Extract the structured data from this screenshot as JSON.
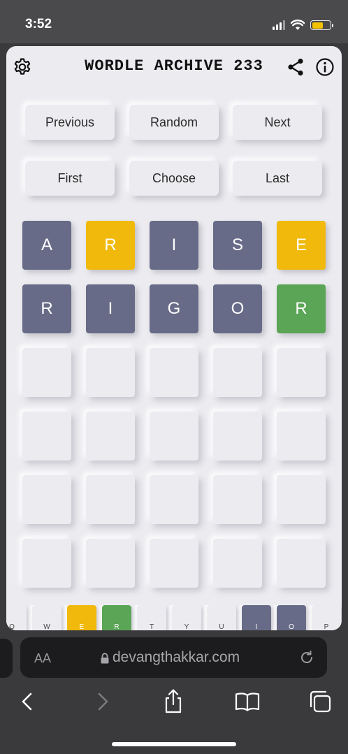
{
  "status": {
    "time": "3:52"
  },
  "header": {
    "title": "WORDLE ARCHIVE 233",
    "settings_icon": "gear-icon",
    "share_icon": "share-icon",
    "info_icon": "info-icon"
  },
  "nav": {
    "previous": "Previous",
    "random": "Random",
    "next": "Next",
    "first": "First",
    "choose": "Choose",
    "last": "Last"
  },
  "board": {
    "rows": [
      [
        {
          "letter": "A",
          "state": "absent"
        },
        {
          "letter": "R",
          "state": "present"
        },
        {
          "letter": "I",
          "state": "absent"
        },
        {
          "letter": "S",
          "state": "absent"
        },
        {
          "letter": "E",
          "state": "present"
        }
      ],
      [
        {
          "letter": "R",
          "state": "absent"
        },
        {
          "letter": "I",
          "state": "absent"
        },
        {
          "letter": "G",
          "state": "absent"
        },
        {
          "letter": "O",
          "state": "absent"
        },
        {
          "letter": "R",
          "state": "correct"
        }
      ],
      [
        {
          "letter": "",
          "state": "empty"
        },
        {
          "letter": "",
          "state": "empty"
        },
        {
          "letter": "",
          "state": "empty"
        },
        {
          "letter": "",
          "state": "empty"
        },
        {
          "letter": "",
          "state": "empty"
        }
      ],
      [
        {
          "letter": "",
          "state": "empty"
        },
        {
          "letter": "",
          "state": "empty"
        },
        {
          "letter": "",
          "state": "empty"
        },
        {
          "letter": "",
          "state": "empty"
        },
        {
          "letter": "",
          "state": "empty"
        }
      ],
      [
        {
          "letter": "",
          "state": "empty"
        },
        {
          "letter": "",
          "state": "empty"
        },
        {
          "letter": "",
          "state": "empty"
        },
        {
          "letter": "",
          "state": "empty"
        },
        {
          "letter": "",
          "state": "empty"
        }
      ],
      [
        {
          "letter": "",
          "state": "empty"
        },
        {
          "letter": "",
          "state": "empty"
        },
        {
          "letter": "",
          "state": "empty"
        },
        {
          "letter": "",
          "state": "empty"
        },
        {
          "letter": "",
          "state": "empty"
        }
      ]
    ]
  },
  "keyboard": {
    "keys": [
      {
        "label": "Q",
        "state": "unused"
      },
      {
        "label": "W",
        "state": "unused"
      },
      {
        "label": "E",
        "state": "present"
      },
      {
        "label": "R",
        "state": "correct"
      },
      {
        "label": "T",
        "state": "unused"
      },
      {
        "label": "Y",
        "state": "unused"
      },
      {
        "label": "U",
        "state": "unused"
      },
      {
        "label": "I",
        "state": "absent"
      },
      {
        "label": "O",
        "state": "absent"
      },
      {
        "label": "P",
        "state": "unused"
      }
    ]
  },
  "browser": {
    "text_size_label": "AA",
    "url": "devangthakkar.com"
  },
  "colors": {
    "absent": "#676b87",
    "present": "#f0b90b",
    "correct": "#5aa556",
    "background": "#ececf0"
  }
}
